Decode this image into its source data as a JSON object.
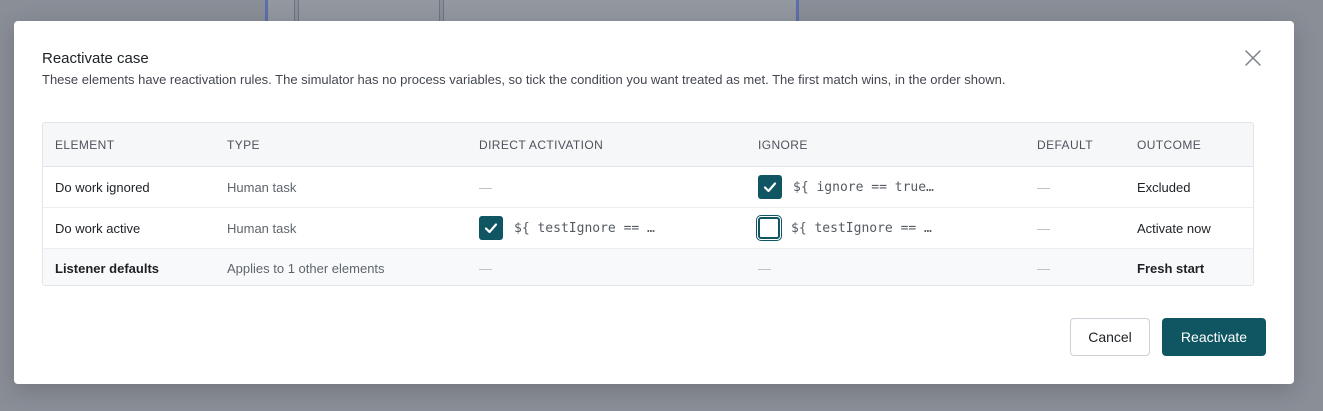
{
  "dialog": {
    "title": "Reactivate case",
    "description": "These elements have reactivation rules. The simulator has no process variables, so tick the condition you want treated as met. The first match wins, in the order shown.",
    "close_icon": "close-icon"
  },
  "table": {
    "headers": {
      "element": "ELEMENT",
      "type": "TYPE",
      "direct": "DIRECT ACTIVATION",
      "ignore": "IGNORE",
      "default": "DEFAULT",
      "outcome": "OUTCOME"
    },
    "rows": [
      {
        "element": "Do work ignored",
        "type": "Human task",
        "direct": "—",
        "ignore_checked": true,
        "ignore_expr": "${ ignore == true…",
        "default": "—",
        "outcome": "Excluded"
      },
      {
        "element": "Do work active",
        "type": "Human task",
        "direct_checked": true,
        "direct_expr": "${ testIgnore == …",
        "ignore_checked": false,
        "ignore_expr": "${ testIgnore == …",
        "default": "—",
        "outcome": "Activate now"
      },
      {
        "element": "Listener defaults",
        "type": "Applies to 1 other elements",
        "direct": "—",
        "ignore": "—",
        "default": "—",
        "outcome": "Fresh start"
      }
    ]
  },
  "footer": {
    "cancel_label": "Cancel",
    "reactivate_label": "Reactivate"
  },
  "colors": {
    "accent": "#0f5662",
    "backdrop": "#8a8e97"
  }
}
